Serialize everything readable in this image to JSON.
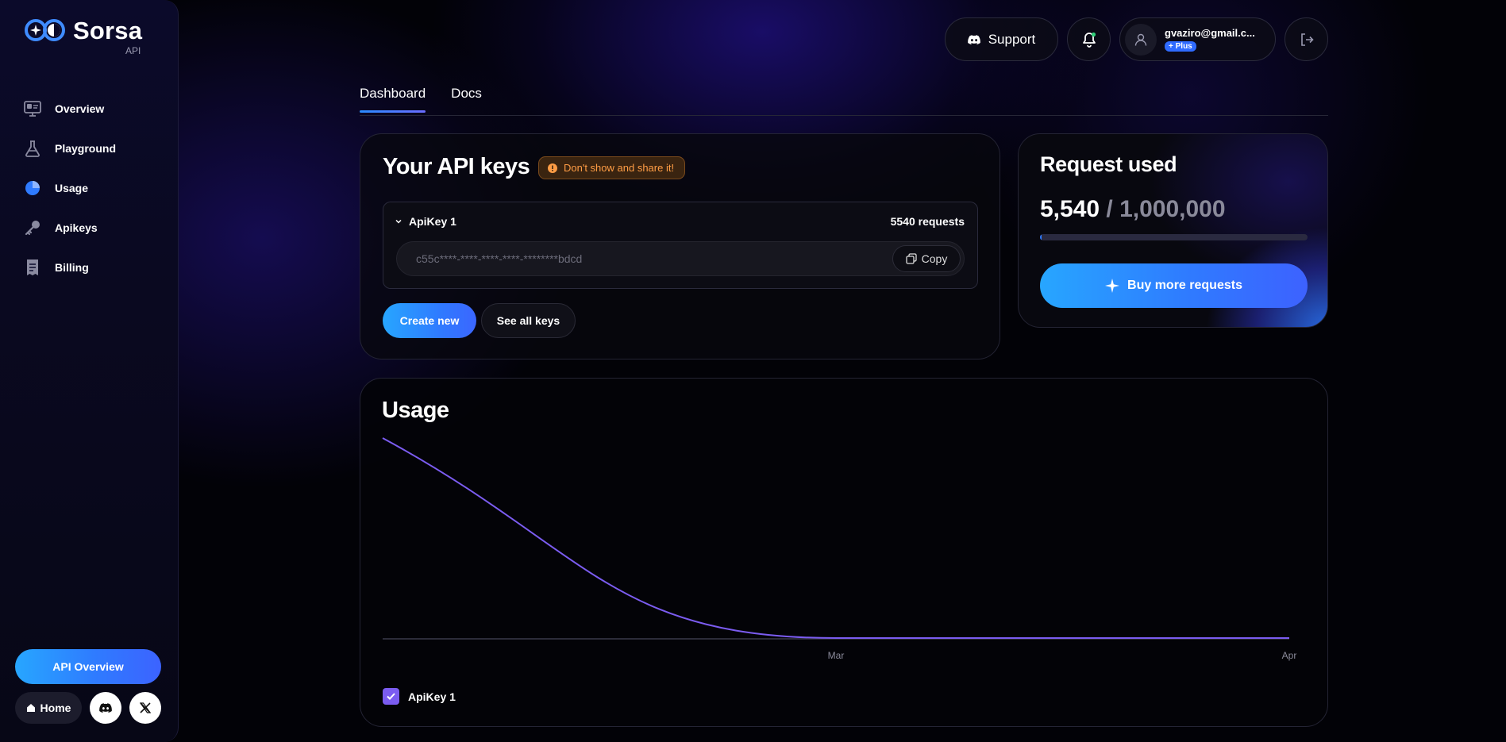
{
  "brand": {
    "name": "Sorsa",
    "sub": "API"
  },
  "sidebar": {
    "items": [
      {
        "label": "Overview",
        "icon": "monitor-icon"
      },
      {
        "label": "Playground",
        "icon": "flask-icon"
      },
      {
        "label": "Usage",
        "icon": "pie-chart-icon"
      },
      {
        "label": "Apikeys",
        "icon": "key-icon"
      },
      {
        "label": "Billing",
        "icon": "receipt-icon"
      }
    ],
    "api_overview_label": "API Overview",
    "home_label": "Home"
  },
  "header": {
    "support_label": "Support",
    "user_email": "gvaziro@gmail.c...",
    "plan_badge": "+ Plus"
  },
  "tabs": [
    {
      "label": "Dashboard",
      "active": true
    },
    {
      "label": "Docs",
      "active": false
    }
  ],
  "api_keys": {
    "title": "Your API keys",
    "warning": "Don't show and share it!",
    "key": {
      "name": "ApiKey 1",
      "requests": "5540 requests",
      "masked_value": "c55c****-****-****-****-********bdcd",
      "copy_label": "Copy"
    },
    "create_label": "Create new",
    "see_all_label": "See all keys"
  },
  "requests": {
    "title": "Request used",
    "used": "5,540",
    "separator": " / ",
    "total": "1,000,000",
    "fraction": 0.00554,
    "buy_label": "Buy more requests"
  },
  "usage": {
    "title": "Usage",
    "legend_label": "ApiKey 1"
  },
  "chart_data": {
    "type": "line",
    "x": [
      "",
      "Mar",
      "Apr"
    ],
    "series": [
      {
        "name": "ApiKey 1",
        "values": [
          5540,
          0,
          0
        ]
      }
    ],
    "tick_labels": [
      "Mar",
      "Apr"
    ],
    "grid": false,
    "legend": "bottom-left"
  },
  "colors": {
    "accent_blue": "#2f7bff",
    "series_purple": "#7b5cf0",
    "warning_orange": "#ff9d45"
  }
}
